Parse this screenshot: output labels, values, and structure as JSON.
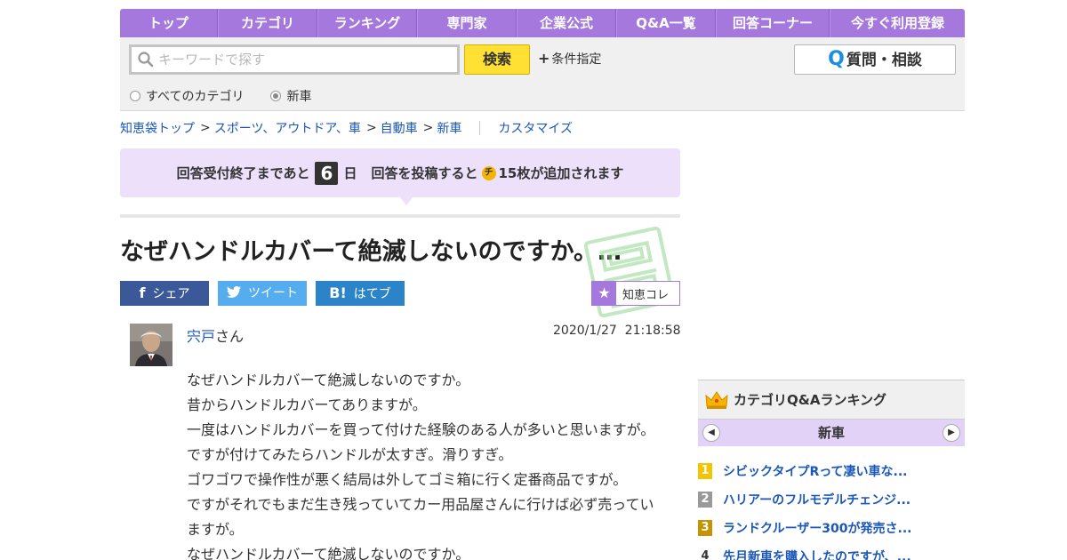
{
  "nav": {
    "items": [
      "トップ",
      "カテゴリ",
      "ランキング",
      "専門家",
      "企業公式",
      "Q&A一覧",
      "回答コーナー",
      "今すぐ利用登録"
    ]
  },
  "search": {
    "placeholder": "キーワードで探す",
    "button_label": "検索",
    "conditions_label": "条件指定",
    "ask_label": "質問・相談",
    "scope_all": "すべてのカテゴリ",
    "scope_current": "新車",
    "scope_selected": "新車"
  },
  "breadcrumb": {
    "items": [
      "知恵袋トップ",
      "スポーツ、アウトドア、車",
      "自動車",
      "新車"
    ],
    "customize": "カスタマイズ"
  },
  "notice": {
    "prefix": "回答受付終了まであと",
    "days": "6",
    "days_unit": "日",
    "middle": "回答を投稿すると",
    "coin_label": "チ",
    "suffix": "15枚が追加されます"
  },
  "question": {
    "title": "なぜハンドルカバーて絶滅しないのですか。…",
    "user_name": "宍戸",
    "user_suffix": "さん",
    "datetime": "2020/1/27  21:18:58",
    "body": [
      "なぜハンドルカバーて絶滅しないのですか。",
      "昔からハンドルカバーてありますが。",
      "一度はハンドルカバーを買って付けた経験のある人が多いと思いますが。",
      "ですが付けてみたらハンドルが太すぎ。滑りすぎ。",
      "ゴワゴワで操作性が悪く結局は外してゴミ箱に行く定番商品ですが。",
      "ですがそれでもまだ生き残っていてカー用品屋さんに行けば必ず売ってい",
      "ますが。",
      "なぜハンドルカバーて絶滅しないのですか。"
    ]
  },
  "share": {
    "facebook": "シェア",
    "twitter": "ツイート",
    "hatena": "はてブ",
    "collection": "知恵コレ"
  },
  "ranking": {
    "title": "カテゴリQ&Aランキング",
    "category": "新車",
    "items": [
      {
        "rank": "1",
        "text": "シビックタイプRって凄い車な..."
      },
      {
        "rank": "2",
        "text": "ハリアーのフルモデルチェンジ..."
      },
      {
        "rank": "3",
        "text": "ランドクルーザー300が発売さ..."
      },
      {
        "rank": "4",
        "text": "先月新車を購入したのですが、..."
      }
    ]
  },
  "colors": {
    "nav_purple": "#a478dc",
    "notice_bg": "#ece0fb",
    "search_button": "#ffe033",
    "link_blue": "#1a57b8",
    "facebook": "#3b5998",
    "twitter": "#55acee",
    "hatena": "#2b84c8"
  }
}
